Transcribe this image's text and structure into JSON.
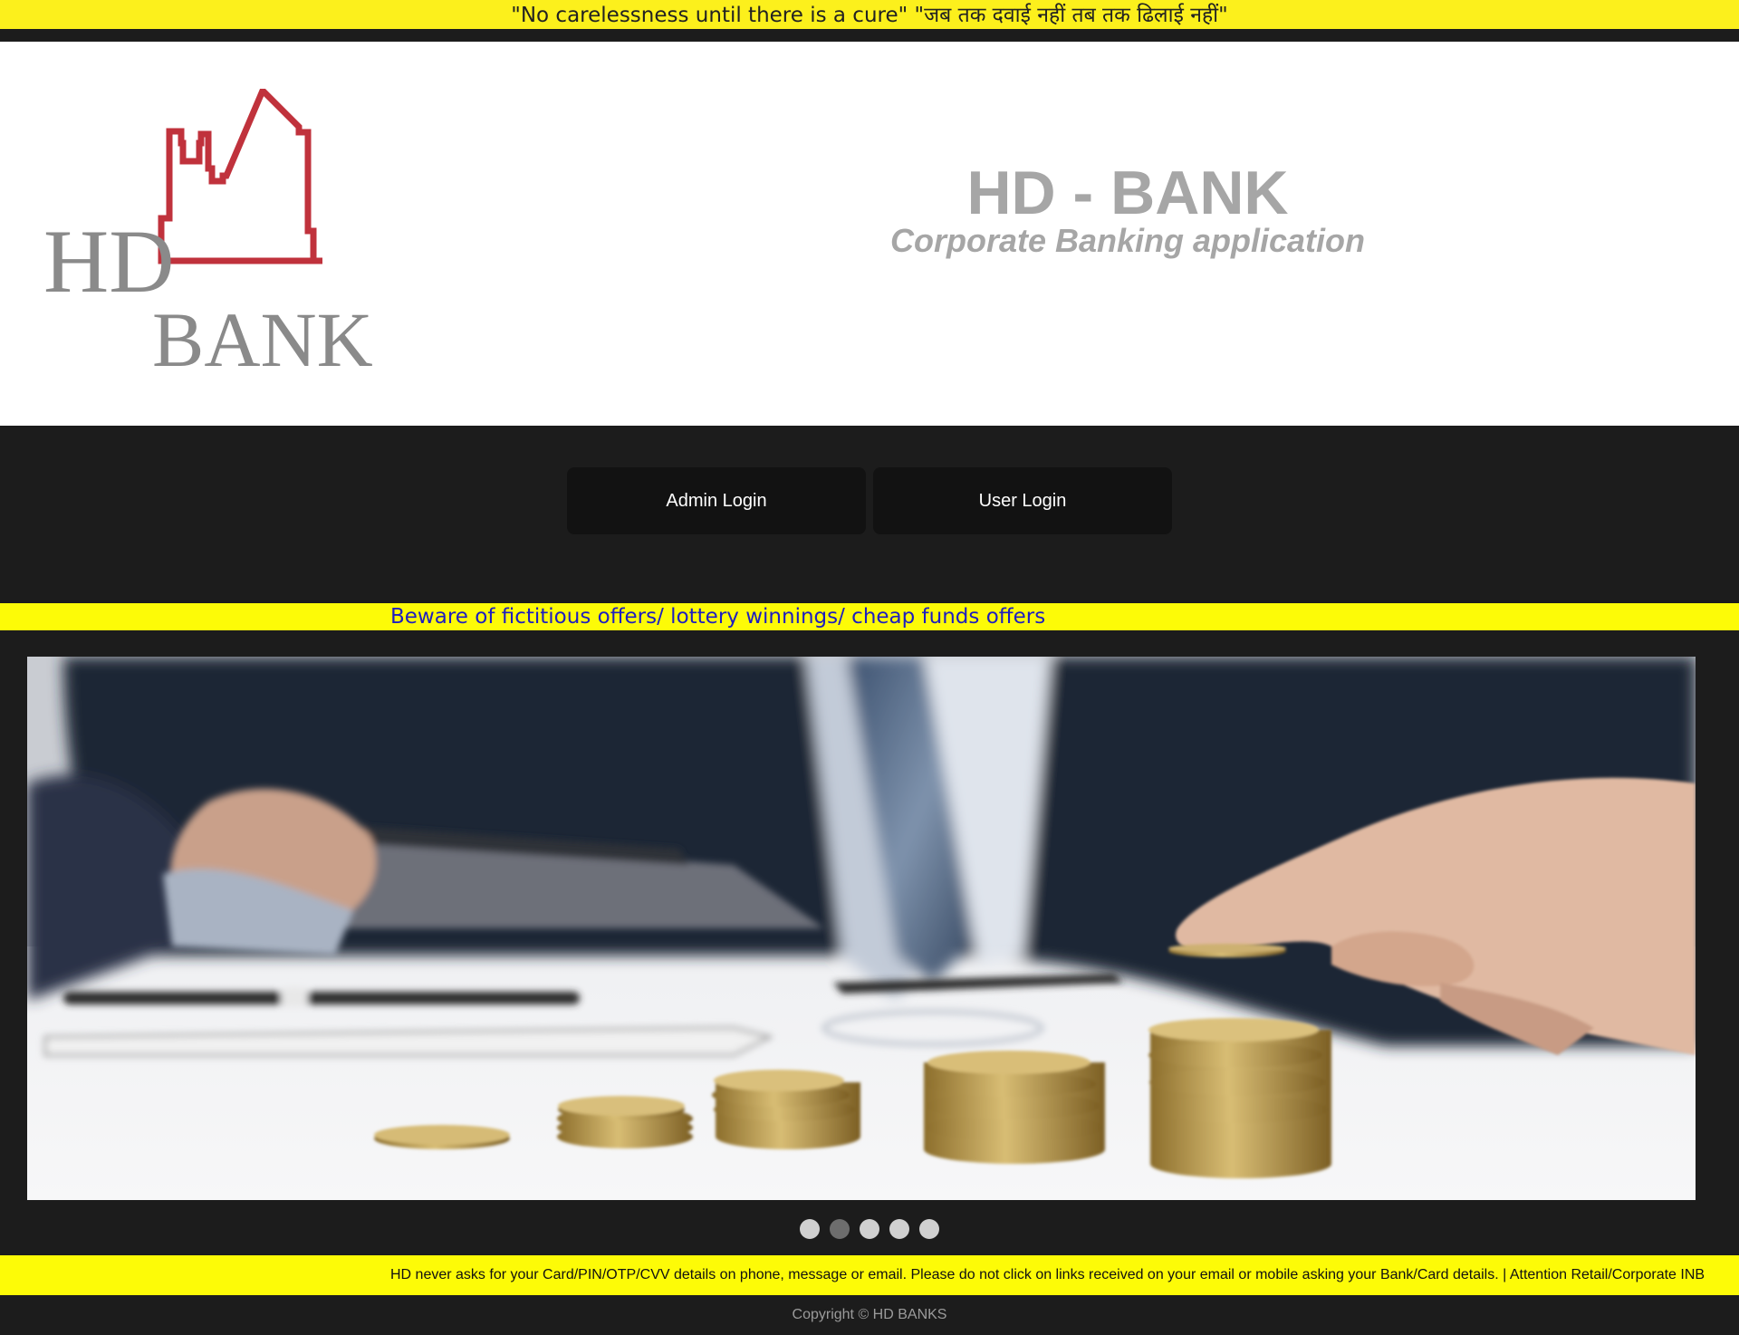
{
  "top_banner": {
    "text": "\"No carelessness until there is a cure\" \"जब तक दवाई नहीं तब तक ढिलाई नहीं\""
  },
  "header": {
    "logo": {
      "line1": "HD",
      "line2": "BANK",
      "icon": "city-skyline-icon",
      "color": "#c0323c"
    },
    "title": "HD - BANK",
    "subtitle": "Corporate Banking application"
  },
  "nav": {
    "admin_login": "Admin Login",
    "user_login": "User Login"
  },
  "warning_ticker": {
    "text": "Beware of fictitious offers/ lottery winnings/ cheap funds offers"
  },
  "slider": {
    "image": "businessman-stacking-coins-photo",
    "slide_count": 5,
    "active_slide": 2
  },
  "notice_ticker": {
    "text": "HD never asks for your Card/PIN/OTP/CVV details on phone, message or email. Please do not click on links received on your email or mobile asking your Bank/Card details. | Attention Retail/Corporate INB"
  },
  "footer": {
    "copyright": "Copyright © HD BANKS"
  },
  "colors": {
    "banner_yellow": "#fcf01c",
    "ticker_yellow": "#fdfb07",
    "dark_bg": "#1c1c1c",
    "title_gray": "#a6a6a6",
    "ticker_text_blue": "#1e1ec0"
  }
}
